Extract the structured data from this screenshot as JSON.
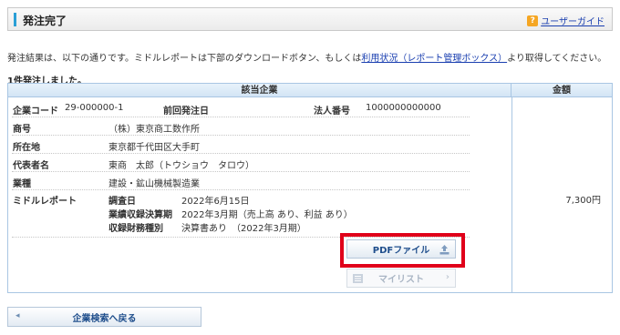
{
  "header": {
    "title": "発注完了",
    "guide_icon": "?",
    "guide_link": "ユーザーガイド"
  },
  "message": {
    "before": "発注結果は、以下の通りです。ミドルレポートは下部のダウンロードボタン、もしくは",
    "link": "利用状況（レポート管理ボックス）",
    "after": "より取得してください。"
  },
  "count_text": "1件発注しました。",
  "table": {
    "header_company": "該当企業",
    "header_amount": "金額",
    "company_code_label": "企業コード",
    "company_code": "29-000000-1",
    "prev_order_label": "前回発注日",
    "prev_order": "",
    "corp_number_label": "法人番号",
    "corp_number": "1000000000000",
    "name_label": "商号",
    "name": "（株）東京商工数作所",
    "address_label": "所在地",
    "address": "東京都千代田区大手町",
    "rep_label": "代表者名",
    "rep": "東商　太郎（トウショウ　タロウ）",
    "industry_label": "業種",
    "industry": "建設・鉱山機械製造業",
    "report_label": "ミドルレポート",
    "report": {
      "survey_date_label": "調査日",
      "survey_date": "2022年6月15日",
      "fiscal_label": "業績収録決算期",
      "fiscal": "2022年3月期（売上高 あり、利益 あり）",
      "financial_label": "収録財務種別",
      "financial": "決算書あり　（2022年3月期）"
    },
    "amount": "7,300円"
  },
  "buttons": {
    "pdf": "PDFファイル",
    "mylist": "マイリスト",
    "back": "企業検索へ戻る"
  },
  "colors": {
    "accent": "#2a9fd6",
    "highlight": "#e0001a",
    "link": "#1a3fb0"
  }
}
